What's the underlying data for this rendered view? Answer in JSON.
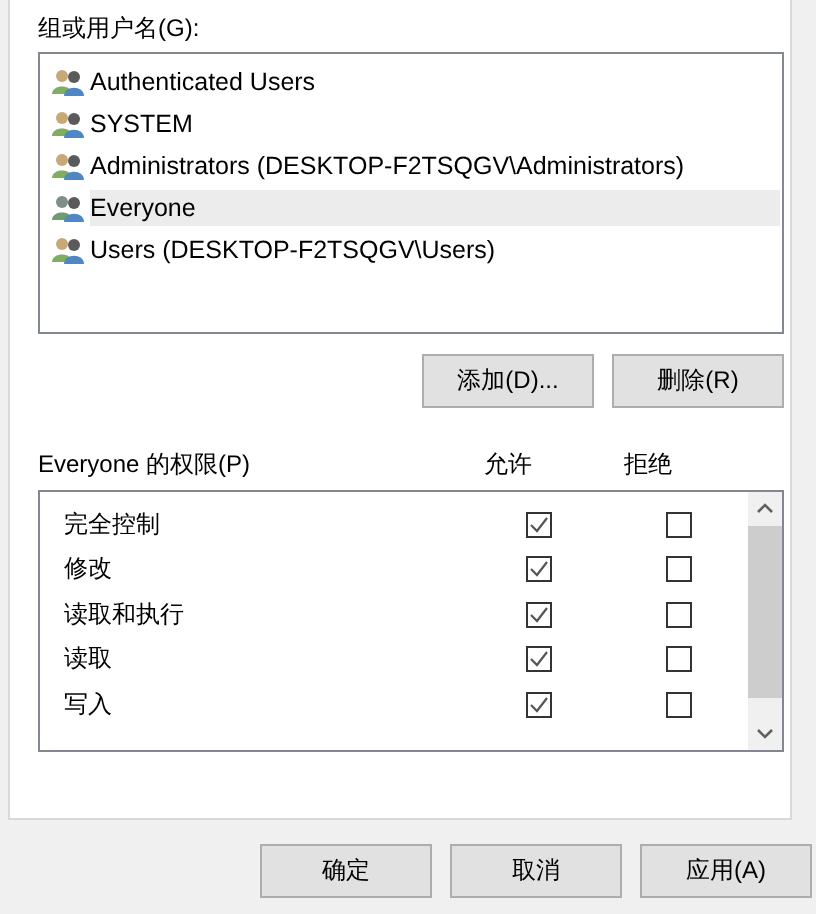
{
  "groups": {
    "label": "组或用户名(G):",
    "items": [
      {
        "name": "Authenticated Users",
        "selected": false
      },
      {
        "name": "SYSTEM",
        "selected": false
      },
      {
        "name": "Administrators (DESKTOP-F2TSQGV\\Administrators)",
        "selected": false
      },
      {
        "name": "Everyone",
        "selected": true
      },
      {
        "name": "Users (DESKTOP-F2TSQGV\\Users)",
        "selected": false
      }
    ]
  },
  "group_buttons": [
    "添加(D)...",
    "删除(R)"
  ],
  "permissions": {
    "label": "Everyone 的权限(P)",
    "allow_header": "允许",
    "deny_header": "拒绝",
    "rows": [
      {
        "name": "完全控制",
        "allow": true,
        "deny": false
      },
      {
        "name": "修改",
        "allow": true,
        "deny": false
      },
      {
        "name": "读取和执行",
        "allow": true,
        "deny": false
      },
      {
        "name": "读取",
        "allow": true,
        "deny": false
      },
      {
        "name": "写入",
        "allow": true,
        "deny": false
      }
    ]
  },
  "buttons": [
    "确定",
    "取消",
    "应用(A)"
  ]
}
